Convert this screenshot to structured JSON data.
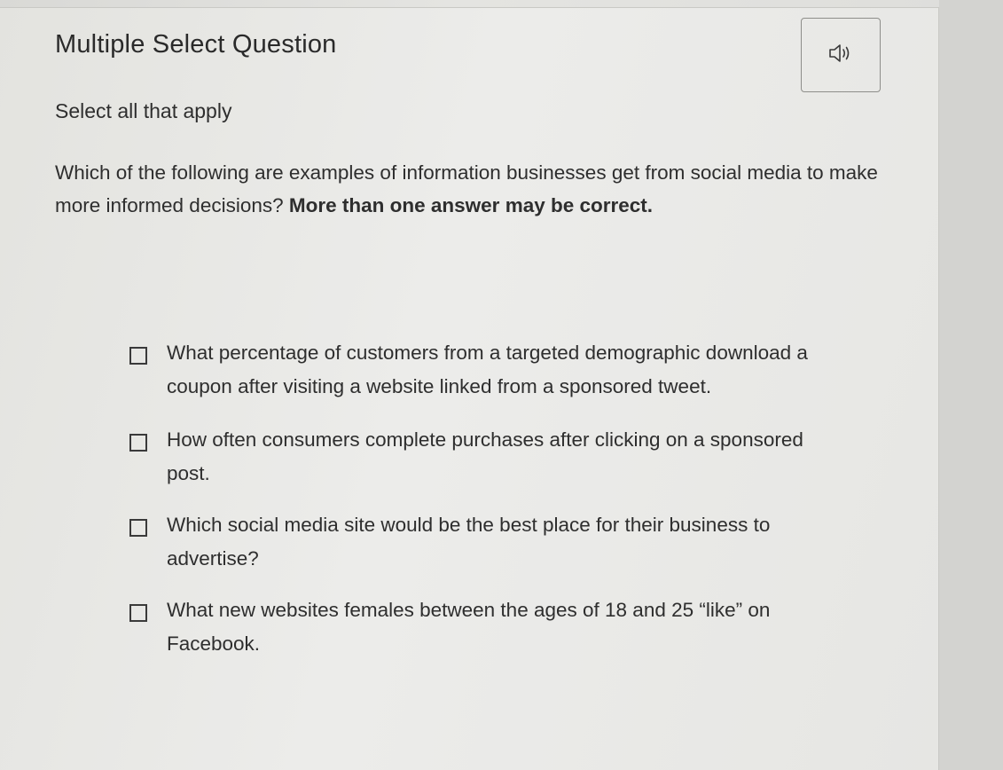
{
  "question": {
    "type_title": "Multiple Select Question",
    "instruction": "Select all that apply",
    "prompt_text": "Which of the following are examples of information businesses get from social media to make more informed decisions?",
    "prompt_bold": "More than one answer may be correct."
  },
  "audio_button": {
    "icon": "speaker-icon"
  },
  "options": [
    {
      "label": "What percentage of customers from a targeted demographic download a coupon after visiting a website linked from a spon­sored tweet.",
      "checked": false
    },
    {
      "label": "How often consumers complete purchases after clicking on a sponsored post.",
      "checked": false
    },
    {
      "label": "Which social media site would be the best place for their busi­ness to advertise?",
      "checked": false
    },
    {
      "label": "What new websites females between the ages of 18 and 25 “like” on Facebook.",
      "checked": false
    }
  ]
}
